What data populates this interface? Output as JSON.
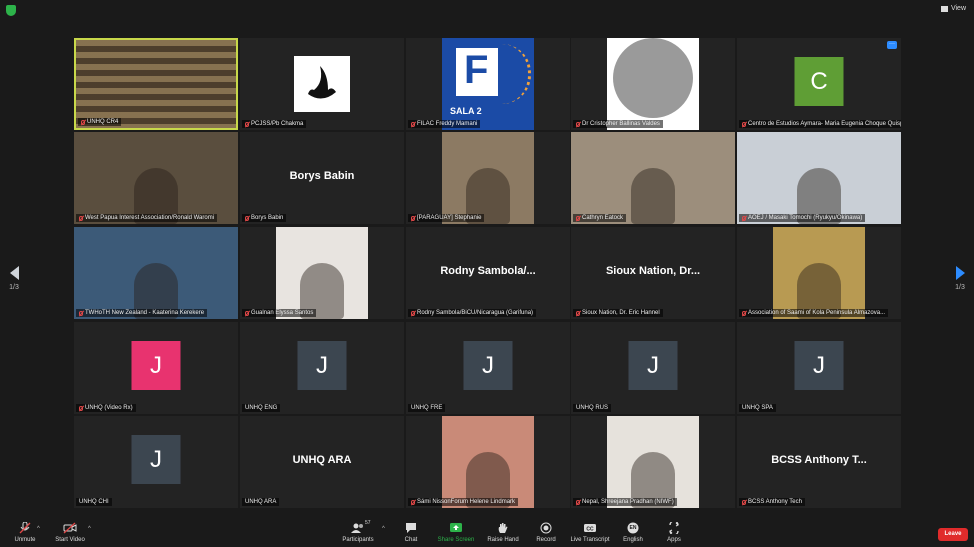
{
  "topbar": {
    "view_label": "View"
  },
  "nav": {
    "left_page": "1/3",
    "right_page": "1/3"
  },
  "tiles": [
    {
      "label": "UNHQ CR4",
      "big": "",
      "avatar": "",
      "avatar_color": "",
      "kind": "video",
      "bg": "#6b5a3c"
    },
    {
      "label": "PCJSS/Pb Chakma",
      "big": "",
      "avatar": "",
      "avatar_color": "",
      "kind": "logo",
      "bg": "#ffffff"
    },
    {
      "label": "FILAC Freddy Mamani",
      "big": "",
      "avatar": "",
      "avatar_color": "",
      "kind": "filac",
      "bg": "#1b4ba6",
      "logo_letter": "F",
      "logo_text": "SALA 2"
    },
    {
      "label": "Dr Cristopher Ballinas Valdes",
      "big": "",
      "avatar": "",
      "avatar_color": "",
      "kind": "photo",
      "bg": "#d8d8d8"
    },
    {
      "label": "Centro de Estudios Aymara- Maria Eugenia Choque Quispe",
      "big": "",
      "avatar": "C",
      "avatar_color": "#5f9e35",
      "kind": "avatar",
      "bg": ""
    },
    {
      "label": "West Papua Interest Association/Ronald Waromi",
      "big": "",
      "avatar": "",
      "avatar_color": "",
      "kind": "video",
      "bg": "#5a4e3e"
    },
    {
      "label": "Borys Babin",
      "big": "Borys Babin",
      "avatar": "",
      "avatar_color": "",
      "kind": "text",
      "bg": ""
    },
    {
      "label": "[PARAGUAY] Stephanie",
      "big": "",
      "avatar": "",
      "avatar_color": "",
      "kind": "video",
      "bg": "#8c7a63"
    },
    {
      "label": "Cathryn Eatock",
      "big": "",
      "avatar": "",
      "avatar_color": "",
      "kind": "video",
      "bg": "#9c8e7c"
    },
    {
      "label": "AOEJ / Masaki Tomochi (Ryukyu/Okinawa)",
      "big": "",
      "avatar": "",
      "avatar_color": "",
      "kind": "video",
      "bg": "#c9cfd6"
    },
    {
      "label": "TWHoTH New Zealand - Kaaterina Kerekere",
      "big": "",
      "avatar": "",
      "avatar_color": "",
      "kind": "video",
      "bg": "#3c5a78"
    },
    {
      "label": "Gualnan Elyssa Santos",
      "big": "",
      "avatar": "",
      "avatar_color": "",
      "kind": "video",
      "bg": "#e8e4e0"
    },
    {
      "label": "Rodny Sambola/BiCU/Nicaragua (Garifuna)",
      "big": "Rodny Sambola/...",
      "avatar": "",
      "avatar_color": "",
      "kind": "text",
      "bg": ""
    },
    {
      "label": "Sioux Nation, Dr. Eric Hannel",
      "big": "Sioux Nation, Dr...",
      "avatar": "",
      "avatar_color": "",
      "kind": "text",
      "bg": ""
    },
    {
      "label": "Association of Saami of Kola Peninsula Almazova...",
      "big": "",
      "avatar": "",
      "avatar_color": "",
      "kind": "video",
      "bg": "#b89a52"
    },
    {
      "label": "UNHQ (Video Rx)",
      "big": "",
      "avatar": "J",
      "avatar_color": "#e8336f",
      "kind": "avatar",
      "bg": ""
    },
    {
      "label": "UNHQ ENG",
      "big": "",
      "avatar": "J",
      "avatar_color": "#3c4650",
      "kind": "avatar",
      "bg": ""
    },
    {
      "label": "UNHQ FRE",
      "big": "",
      "avatar": "J",
      "avatar_color": "#3c4650",
      "kind": "avatar",
      "bg": ""
    },
    {
      "label": "UNHQ RUS",
      "big": "",
      "avatar": "J",
      "avatar_color": "#3c4650",
      "kind": "avatar",
      "bg": ""
    },
    {
      "label": "UNHQ SPA",
      "big": "",
      "avatar": "J",
      "avatar_color": "#3c4650",
      "kind": "avatar",
      "bg": ""
    },
    {
      "label": "UNHQ CHI",
      "big": "",
      "avatar": "J",
      "avatar_color": "#3c4650",
      "kind": "avatar",
      "bg": ""
    },
    {
      "label": "UNHQ ARA",
      "big": "UNHQ ARA",
      "avatar": "",
      "avatar_color": "",
      "kind": "text",
      "bg": ""
    },
    {
      "label": "Sámi NissonForum Helene Lindmark",
      "big": "",
      "avatar": "",
      "avatar_color": "",
      "kind": "video",
      "bg": "#c98a78"
    },
    {
      "label": "Nepal, Shreejana Pradhan (NIWF)",
      "big": "",
      "avatar": "",
      "avatar_color": "",
      "kind": "video",
      "bg": "#e6e2dc"
    },
    {
      "label": "BCSS Anthony Tech",
      "big": "BCSS Anthony T...",
      "avatar": "",
      "avatar_color": "",
      "kind": "text",
      "bg": ""
    }
  ],
  "toolbar": {
    "unmute": "Unmute",
    "start_video": "Start Video",
    "participants": "Participants",
    "participants_count": "57",
    "chat": "Chat",
    "share_screen": "Share Screen",
    "raise_hand": "Raise Hand",
    "record": "Record",
    "live_transcript": "Live Transcript",
    "english": "English",
    "english_badge": "EN",
    "apps": "Apps",
    "leave": "Leave",
    "share_color": "#2db34a",
    "leave_color": "#e02b2b"
  }
}
